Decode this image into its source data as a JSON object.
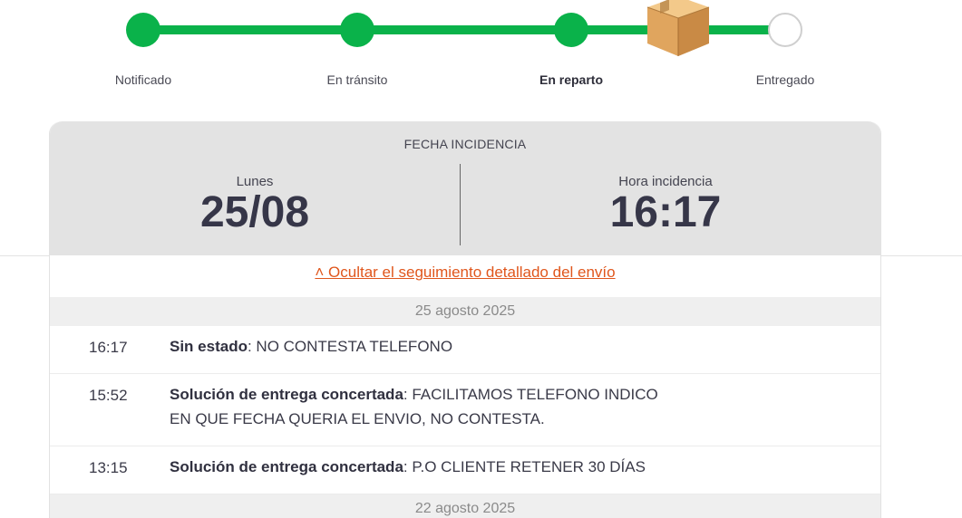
{
  "tracker": {
    "steps": [
      {
        "label": "Notificado",
        "done": true
      },
      {
        "label": "En tránsito",
        "done": true
      },
      {
        "label": "En reparto",
        "done": true,
        "current": true
      },
      {
        "label": "Entregado",
        "done": false
      }
    ],
    "colors": {
      "done": "#0ab24a",
      "pending": "#ffffff"
    },
    "package_icon": "package-box-icon"
  },
  "incident": {
    "title": "FECHA INCIDENCIA",
    "day_label": "Lunes",
    "date": "25/08",
    "time_label": "Hora incidencia",
    "time": "16:17"
  },
  "toggle_link": "˄ Ocultar el seguimiento detallado del envío",
  "history": [
    {
      "date": "25 agosto 2025",
      "events": [
        {
          "time": "16:17",
          "status": "Sin estado",
          "detail": ": NO CONTESTA TELEFONO"
        },
        {
          "time": "15:52",
          "status": "Solución de entrega concertada",
          "detail": ": FACILITAMOS TELEFONO INDICO EN QUE FECHA QUERIA EL ENVIO, NO CONTESTA."
        },
        {
          "time": "13:15",
          "status": "Solución de entrega concertada",
          "detail": ": P.O CLIENTE RETENER 30 DÍAS"
        }
      ]
    },
    {
      "date": "22 agosto 2025",
      "events": []
    }
  ],
  "accent_color": "#e0561c"
}
